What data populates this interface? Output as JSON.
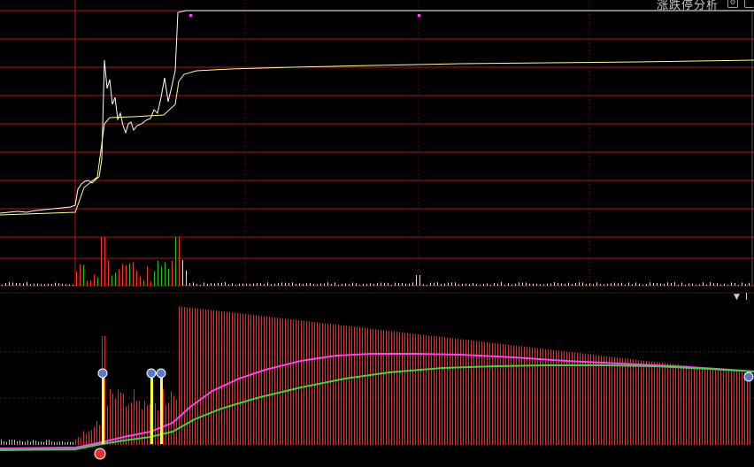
{
  "header": {
    "title": "涨跌停分析"
  },
  "colors": {
    "grid_red": "#b01616",
    "price_line": "#ffffff",
    "avg_line": "#ffff80",
    "vol_up": "#ff3030",
    "vol_down": "#20c020",
    "vol_flat": "#e0e0e0",
    "magenta": "#ff40ff",
    "green_line": "#30e030",
    "yellow_marker": "#ffff30"
  },
  "icons": {
    "settings": "gear-icon",
    "window": "window-icon",
    "dropdown": "chevron-down-icon"
  }
}
